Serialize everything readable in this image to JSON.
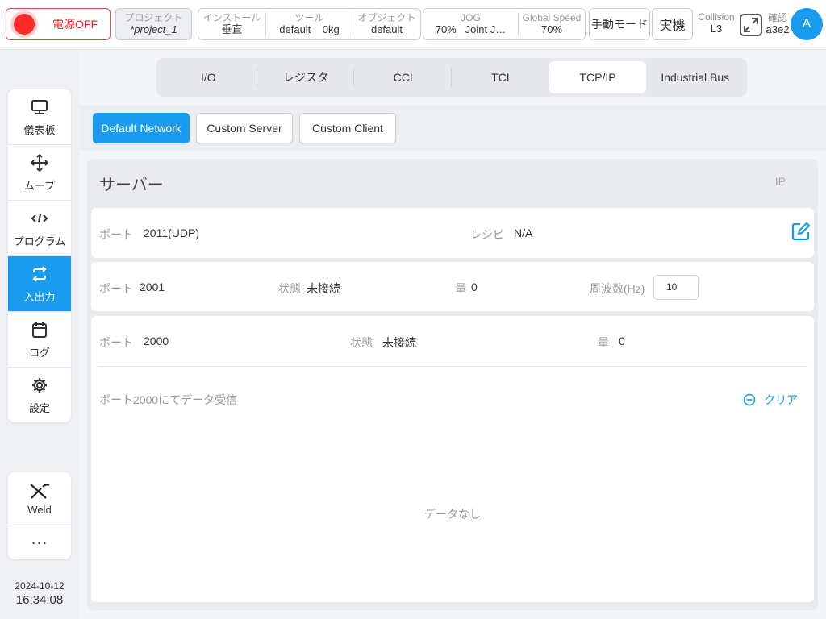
{
  "topbar": {
    "power_label": "電源OFF",
    "project_label": "プロジェクト",
    "project_value": "*project_1",
    "install_label": "インストール",
    "install_value": "垂直",
    "tool_label": "ツール",
    "tool_value": "default",
    "tool_weight": "0kg",
    "object_label": "オブジェクト",
    "object_value": "default",
    "jog_label": "JOG",
    "jog_value": "70%",
    "jog_mode": "Joint J…",
    "global_speed_label": "Global Speed",
    "global_speed_value": "70%",
    "manual_mode": "手動モード",
    "real_machine": "実機",
    "collision_label": "Collision",
    "collision_value": "L3",
    "confirm_label": "確認",
    "confirm_value": "a3e2",
    "avatar_letter": "A",
    "accent_color": "#1a9bf0",
    "power_color": "#ff2b2b"
  },
  "sidebar": {
    "items": [
      {
        "label": "儀表板",
        "icon": "monitor-icon"
      },
      {
        "label": "ムーブ",
        "icon": "move-icon"
      },
      {
        "label": "プログラム",
        "icon": "code-icon"
      },
      {
        "label": "入出力",
        "icon": "swap-icon",
        "active": true
      },
      {
        "label": "ログ",
        "icon": "calendar-icon"
      },
      {
        "label": "設定",
        "icon": "gear-icon"
      }
    ],
    "weld_label": "Weld",
    "more_label": "···",
    "date": "2024-10-12",
    "time": "16:34:08"
  },
  "tabs": [
    {
      "label": "I/O"
    },
    {
      "label": "レジスタ"
    },
    {
      "label": "CCI"
    },
    {
      "label": "TCI"
    },
    {
      "label": "TCP/IP",
      "active": true
    },
    {
      "label": "Industrial Bus"
    }
  ],
  "subtabs": [
    {
      "label": "Default Network",
      "active": true
    },
    {
      "label": "Custom Server"
    },
    {
      "label": "Custom Client"
    }
  ],
  "server": {
    "title": "サーバー",
    "ip_label": "IP",
    "row1": {
      "port_label": "ポート",
      "port_value": "2011(UDP)",
      "recipe_label": "レシピ",
      "recipe_value": "N/A"
    },
    "row2": {
      "port_label": "ポート",
      "port_value": "2001",
      "status_label": "状態",
      "status_value": "未接続",
      "amount_label": "量",
      "amount_value": "0",
      "freq_label": "周波数(Hz)",
      "freq_value": "10"
    },
    "row3": {
      "port_label": "ポート",
      "port_value": "2000",
      "status_label": "状態",
      "status_value": "未接続",
      "amount_label": "量",
      "amount_value": "0",
      "receive_label": "ポート2000にてデータ受信",
      "clear_label": "クリア",
      "empty_label": "データなし"
    }
  }
}
